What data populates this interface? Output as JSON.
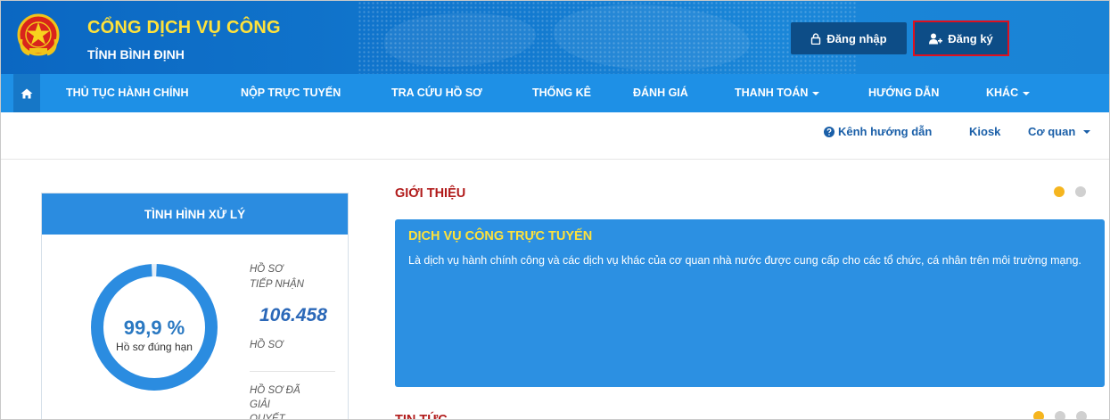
{
  "header": {
    "title": "CỔNG DỊCH VỤ CÔNG",
    "subtitle": "TỈNH BÌNH ĐỊNH",
    "login_label": "Đăng nhập",
    "register_label": "Đăng ký",
    "background_color": "#1279cf",
    "title_color": "#ffe23a",
    "register_highlight_color": "#e0101e"
  },
  "nav": {
    "home_icon": "home-icon",
    "items": [
      {
        "label": "THỦ TỤC HÀNH CHÍNH"
      },
      {
        "label": "NỘP TRỰC TUYẾN"
      },
      {
        "label": "TRA CỨU HỒ SƠ"
      },
      {
        "label": "THỐNG KÊ"
      },
      {
        "label": "ĐÁNH GIÁ"
      },
      {
        "label": "THANH TOÁN"
      },
      {
        "label": "HƯỚNG DẪN"
      },
      {
        "label": "KHÁC"
      }
    ],
    "background_color": "#1e90e6"
  },
  "subnav": {
    "guide_label": "Kênh hướng dẫn",
    "kiosk_label": "Kiosk",
    "agency_label": "Cơ quan"
  },
  "stats": {
    "title": "TÌNH HÌNH XỬ LÝ",
    "on_time_percent": "99,9 %",
    "on_time_fraction": 0.999,
    "on_time_caption": "Hồ sơ đúng hạn",
    "received_label_line1": "HỒ SƠ",
    "received_label_line2": "TIẾP NHẬN",
    "received_value": "106.458",
    "received_unit": "HỒ SƠ",
    "resolved_label_line1": "HỒ SƠ ĐÃ",
    "resolved_label_line2": "GIẢI",
    "resolved_label_line3": "QUYẾT",
    "ring_color": "#2b8ce0"
  },
  "intro": {
    "section_title": "GIỚI THIỆU",
    "card_title": "DỊCH VỤ CÔNG TRỰC TUYẾN",
    "card_text": "Là dịch vụ hành chính công và các dịch vụ khác của cơ quan nhà nước được cung cấp cho các tổ chức, cá nhân trên môi trường mạng.",
    "active_dot_color": "#f5b51f",
    "inactive_dot_color": "#d0d0d0"
  },
  "news": {
    "section_title": "TIN TỨC"
  }
}
